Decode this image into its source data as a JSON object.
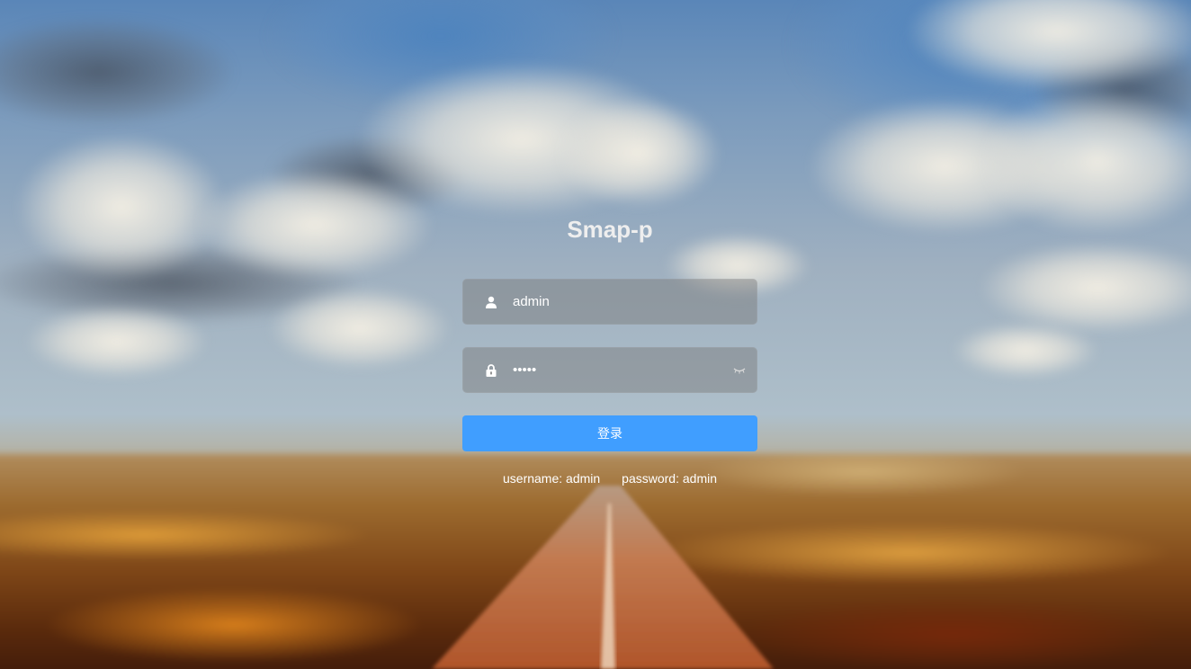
{
  "app": {
    "title": "Smap-p"
  },
  "form": {
    "username": {
      "value": "admin",
      "icon": "user-icon"
    },
    "password": {
      "value": "admin",
      "icon": "lock-icon",
      "toggle_icon": "eye-closed-icon"
    },
    "login_label": "登录"
  },
  "tips": {
    "username": "username: admin",
    "password": "password: admin"
  },
  "colors": {
    "primary": "#409eff",
    "title": "#eeeeee"
  }
}
